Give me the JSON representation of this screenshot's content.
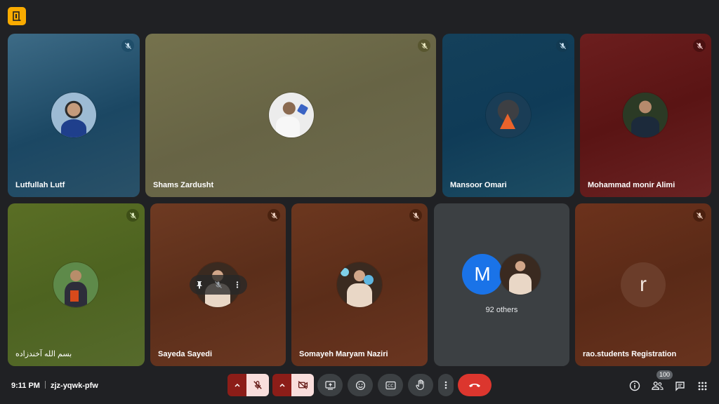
{
  "participants": [
    {
      "name": "Lutfullah Lutf"
    },
    {
      "name": "Shams Zardusht"
    },
    {
      "name": "Mansoor Omari"
    },
    {
      "name": "Mohammad monir Alimi"
    },
    {
      "name": "بسم الله آخندزاده"
    },
    {
      "name": "Sayeda Sayedi"
    },
    {
      "name": "Somayeh Maryam Naziri"
    },
    {
      "name": "rao.students Registration",
      "initial": "r"
    }
  ],
  "others": {
    "initial": "M",
    "count_label": "92 others"
  },
  "footer": {
    "time": "9:11 PM",
    "meeting_code": "zjz-yqwk-pfw",
    "people_count": "100"
  },
  "icons": {
    "logo": "door-exit-icon",
    "mic_off": "mic-off-icon",
    "camera_off": "videocam-off-icon",
    "present": "present-screen-icon",
    "emoji": "emoji-icon",
    "captions": "closed-caption-icon",
    "raise_hand": "raise-hand-icon",
    "more": "more-vert-icon",
    "end_call": "call-end-icon",
    "info": "info-icon",
    "people": "people-icon",
    "chat": "chat-icon",
    "activities": "apps-grid-icon"
  },
  "colors": {
    "background": "#202124",
    "end_call": "#dc362e",
    "muted_split": "#8c1d18",
    "muted_active": "#f9dedc",
    "blue_avatar": "#1a73e8"
  }
}
